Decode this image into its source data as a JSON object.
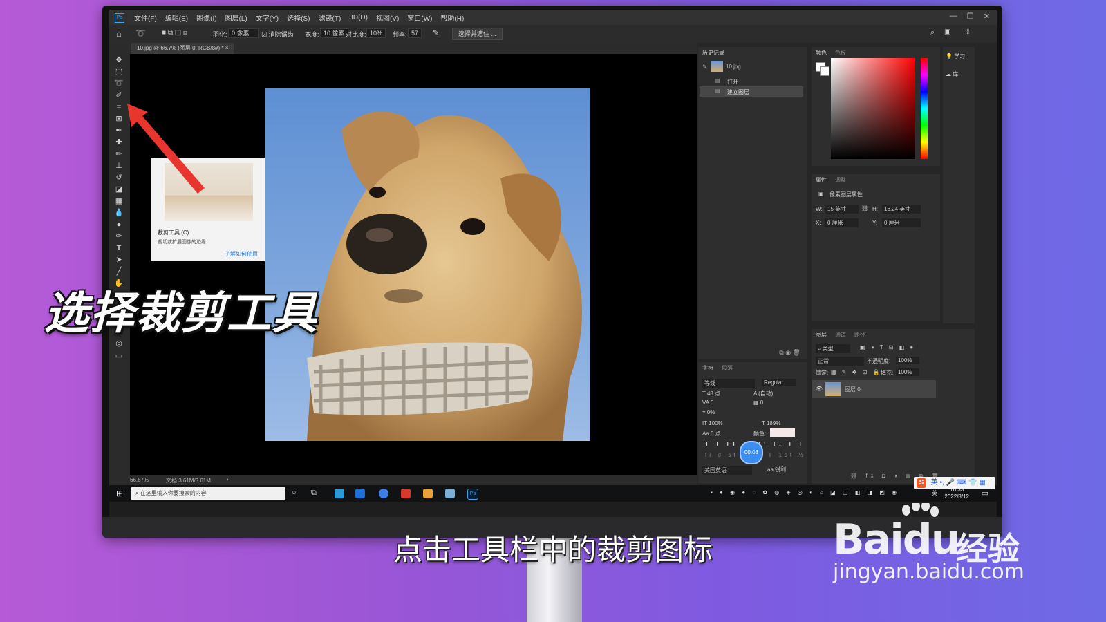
{
  "app": {
    "menu": [
      "文件(F)",
      "编辑(E)",
      "图像(I)",
      "图层(L)",
      "文字(Y)",
      "选择(S)",
      "滤镜(T)",
      "3D(D)",
      "视图(V)",
      "窗口(W)",
      "帮助(H)"
    ],
    "window_controls": [
      "—",
      "❐",
      "✕"
    ]
  },
  "options_bar": {
    "feather_label": "羽化:",
    "feather_value": "0 像素",
    "antialias_label": "消除锯齿",
    "width_label": "宽度:",
    "width_value": "10 像素",
    "contrast_label": "对比度:",
    "contrast_value": "10%",
    "frequency_label": "频率:",
    "frequency_value": "57",
    "select_mask_button": "选择并遮住 ..."
  },
  "document": {
    "tab_title": "10.jpg @ 66.7% (图层 0, RGB/8#) *",
    "zoom": "66.67%",
    "doc_info": "文档:3.61M/3.61M"
  },
  "tooltip": {
    "title": "裁剪工具 (C)",
    "description": "裁切或扩展图像的边缘",
    "link": "了解如何使用"
  },
  "history_panel": {
    "tab": "历史记录",
    "snapshot": "10.jpg",
    "items": [
      "打开",
      "建立图层"
    ]
  },
  "color_panel": {
    "tabs": [
      "颜色",
      "色板"
    ]
  },
  "learn_panel": {
    "items": [
      "学习",
      "库"
    ]
  },
  "properties_panel": {
    "tabs": [
      "属性",
      "调整"
    ],
    "type": "像素图层属性",
    "w_label": "W:",
    "w_value": "15 英寸",
    "h_label": "H:",
    "h_value": "16.24 英寸",
    "x_label": "X:",
    "x_value": "0 厘米",
    "y_label": "Y:",
    "y_value": "0 厘米"
  },
  "character_panel": {
    "tabs": [
      "字符",
      "段落"
    ],
    "font": "等线",
    "style": "Regular",
    "size": "48 点",
    "leading": "(自动)",
    "kerning": "0",
    "tracking": "0",
    "scale_pct": "0%",
    "vscale": "100%",
    "hscale": "189%",
    "baseline": "0 点",
    "color_label": "颜色:",
    "language": "美国英语",
    "antialias": "锐利",
    "timer": "00:08"
  },
  "layers_panel": {
    "tabs": [
      "图层",
      "通道",
      "路径"
    ],
    "filter": "类型",
    "blend_mode": "正常",
    "opacity_label": "不透明度:",
    "opacity": "100%",
    "lock_label": "锁定:",
    "fill_label": "填充:",
    "fill": "100%",
    "layer_name": "图层 0"
  },
  "taskbar": {
    "search_placeholder": "在这里输入你要搜索的内容",
    "time": "16:33",
    "date": "2022/8/12",
    "ime_lang": "英"
  },
  "overlay": {
    "title": "选择裁剪工具",
    "subtitle": "点击工具栏中的裁剪图标"
  },
  "watermark": {
    "brand": "Baidu",
    "brand_cn": "经验",
    "url": "jingyan.baidu.com"
  },
  "colors": {
    "ps_blue": "#31a8ff",
    "panel_bg": "#2e2e2e",
    "arrow_red": "#e8362f"
  }
}
